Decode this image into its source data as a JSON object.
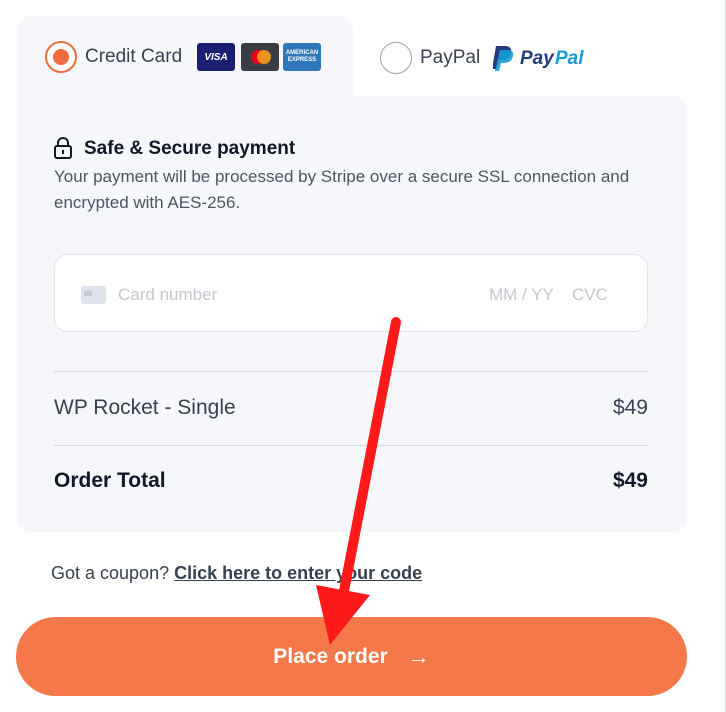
{
  "tabs": {
    "credit_card": {
      "label": "Credit Card",
      "selected": true,
      "logos": [
        "visa-logo",
        "mastercard-logo",
        "amex-logo"
      ],
      "visa_text": "VISA",
      "amex_text": "AMERICAN EXPRESS"
    },
    "paypal": {
      "label": "PayPal",
      "selected": false,
      "logo_text_pay": "Pay",
      "logo_text_pal": "Pal"
    }
  },
  "secure": {
    "title": "Safe & Secure payment",
    "description": "Your payment will be processed by Stripe over a secure SSL connection and encrypted with AES-256."
  },
  "card_field": {
    "number_placeholder": "Card number",
    "expiry_placeholder": "MM / YY",
    "cvc_placeholder": "CVC"
  },
  "order": {
    "item_label": "WP Rocket - Single",
    "item_price": "$49",
    "total_label": "Order Total",
    "total_price": "$49"
  },
  "coupon": {
    "prompt": "Got a coupon?",
    "link": "Click here to enter your code"
  },
  "place_order": {
    "label": "Place order",
    "arrow": "→"
  },
  "colors": {
    "accent": "#f4784a",
    "radio_active": "#f06b3e",
    "annotation_arrow": "#ff1a1a",
    "panel_bg": "#f6f7fb"
  }
}
